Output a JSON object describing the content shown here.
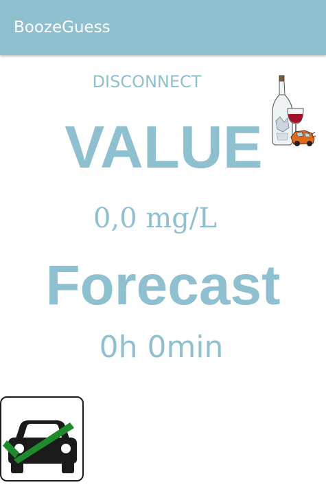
{
  "app_bar": {
    "title": "BoozeGuess",
    "color": "#8fc0cf"
  },
  "connection": {
    "button_label": "DISCONNECT"
  },
  "reading": {
    "heading": "VALUE",
    "value": "0,0 mg/L"
  },
  "forecast": {
    "heading": "Forecast",
    "time": "0h 0min"
  },
  "icons": {
    "logo": "wine-bottle-crashed-car-icon",
    "drive_status": "car-checkmark-icon"
  },
  "colors": {
    "accent": "#8fc0cf",
    "check": "#1f8a2c",
    "car": "#1a1a1a"
  }
}
